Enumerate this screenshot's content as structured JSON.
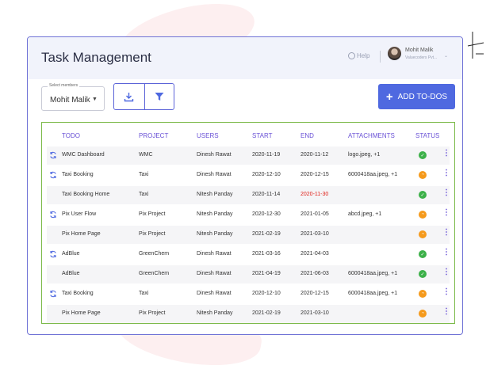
{
  "header": {
    "title": "Task Management",
    "help_label": "Help",
    "user_name": "Mohit Malik",
    "user_org": "Valuecoders Pvt..."
  },
  "filters": {
    "select_label": "Select members",
    "select_value": "Mohit Malik"
  },
  "actions": {
    "add_label": "ADD TO-DOS"
  },
  "table": {
    "columns": [
      "TODO",
      "PROJECT",
      "USERS",
      "START",
      "END",
      "ATTACHMENTS",
      "STATUS"
    ],
    "rows": [
      {
        "todo": "WMC Dashboard",
        "project": "WMC",
        "user": "Dinesh Rawat",
        "start": "2020-11-19",
        "end": "2020-11-12",
        "attachments": "logo.jpeg, +1",
        "status": "done",
        "recurring": true,
        "end_overdue": false
      },
      {
        "todo": "Taxi Booking",
        "project": "Taxi",
        "user": "Dinesh Rawat",
        "start": "2020-12-10",
        "end": "2020-12-15",
        "attachments": "6000418aa.jpeg, +1",
        "status": "pending",
        "recurring": true,
        "end_overdue": false
      },
      {
        "todo": "Taxi Booking Home",
        "project": "Taxi",
        "user": "Nitesh Panday",
        "start": "2020-11-14",
        "end": "2020-11-30",
        "attachments": "",
        "status": "done",
        "recurring": false,
        "end_overdue": true
      },
      {
        "todo": "Pix User Flow",
        "project": "Pix Project",
        "user": "Nitesh Panday",
        "start": "2020-12-30",
        "end": "2021-01-05",
        "attachments": "abcd.jpeg, +1",
        "status": "pending",
        "recurring": true,
        "end_overdue": false
      },
      {
        "todo": "Pix Home Page",
        "project": "Pix Project",
        "user": "Nitesh Panday",
        "start": "2021-02-19",
        "end": "2021-03-10",
        "attachments": "",
        "status": "pending",
        "recurring": false,
        "end_overdue": false
      },
      {
        "todo": "AdBlue",
        "project": "GreenChem",
        "user": "Dinesh Rawat",
        "start": "2021-03-16",
        "end": "2021-04-03",
        "attachments": "",
        "status": "done",
        "recurring": true,
        "end_overdue": false
      },
      {
        "todo": "AdBlue",
        "project": "GreenChem",
        "user": "Dinesh Rawat",
        "start": "2021-04-19",
        "end": "2021-06-03",
        "attachments": "6000418aa.jpeg, +1",
        "status": "done",
        "recurring": false,
        "end_overdue": false
      },
      {
        "todo": "Taxi Booking",
        "project": "Taxi",
        "user": "Dinesh Rawat",
        "start": "2020-12-10",
        "end": "2020-12-15",
        "attachments": "6000418aa.jpeg, +1",
        "status": "pending",
        "recurring": true,
        "end_overdue": false
      },
      {
        "todo": "Pix Home Page",
        "project": "Pix Project",
        "user": "Nitesh Panday",
        "start": "2021-02-19",
        "end": "2021-03-10",
        "attachments": "",
        "status": "pending",
        "recurring": false,
        "end_overdue": false
      }
    ]
  },
  "colors": {
    "accent": "#4f69e0",
    "header_text": "#6a52d6",
    "table_border": "#7cba4a",
    "status_done": "#3cb049",
    "status_pending": "#f59a1c",
    "overdue": "#e0221a"
  },
  "icons": {
    "help": "help-circle-icon",
    "download": "download-icon",
    "filter": "filter-icon",
    "recurring": "sync-icon",
    "row_menu": "kebab-menu-icon"
  }
}
